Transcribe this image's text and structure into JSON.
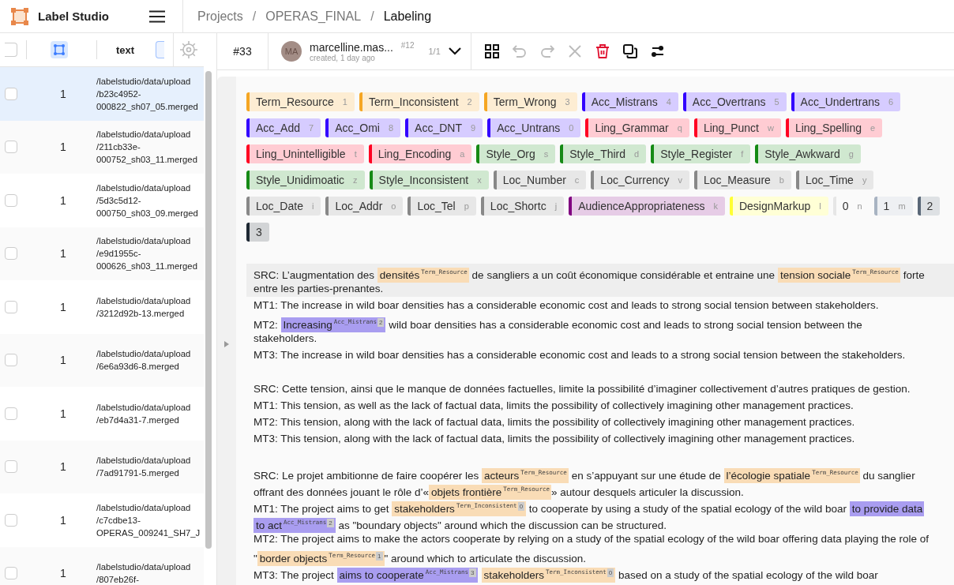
{
  "app": {
    "name": "Label Studio"
  },
  "breadcrumbs": [
    {
      "text": "Projects",
      "current": false
    },
    {
      "separator": "/",
      "text": "OPERAS_FINAL",
      "current": false
    },
    {
      "separator": "/",
      "text": "Labeling",
      "current": true
    }
  ],
  "table": {
    "all_checked": false,
    "header": "text",
    "rows": [
      {
        "selected": true,
        "checked": false,
        "count": "1",
        "lines": [
          "/labelstudio/data/upload",
          "/b23c4952-",
          "000822_sh07_05.merged"
        ]
      },
      {
        "selected": false,
        "checked": false,
        "count": "1",
        "lines": [
          "/labelstudio/data/upload",
          "/211cb33e-",
          "000752_sh03_11.merged"
        ]
      },
      {
        "selected": false,
        "checked": false,
        "count": "1",
        "lines": [
          "/labelstudio/data/upload",
          "/5d3c5d12-",
          "000750_sh03_09.merged"
        ]
      },
      {
        "selected": false,
        "checked": false,
        "count": "1",
        "lines": [
          "/labelstudio/data/upload",
          "/e9d1955c-",
          "000626_sh03_11.merged"
        ]
      },
      {
        "selected": false,
        "checked": false,
        "count": "1",
        "lines": [
          "/labelstudio/data/upload",
          "/3212d92b-13.merged"
        ]
      },
      {
        "selected": false,
        "checked": false,
        "count": "1",
        "lines": [
          "/labelstudio/data/upload",
          "/6e6a93d6-8.merged"
        ]
      },
      {
        "selected": false,
        "checked": false,
        "count": "1",
        "lines": [
          "/labelstudio/data/upload",
          "/eb7d4a31-7.merged"
        ]
      },
      {
        "selected": false,
        "checked": false,
        "count": "1",
        "lines": [
          "/labelstudio/data/upload",
          "/7ad91791-5.merged"
        ]
      },
      {
        "selected": false,
        "checked": false,
        "count": "1",
        "lines": [
          "/labelstudio/data/upload",
          "/c7cdbe13-",
          "OPERAS_009241_SH7_J"
        ]
      },
      {
        "selected": false,
        "checked": false,
        "count": "1",
        "lines": [
          "/labelstudio/data/upload",
          "/807eb26f-"
        ]
      }
    ]
  },
  "annotation": {
    "task": "#33",
    "avatar": "MA",
    "user": "marcelline.mas...",
    "created": "created, 1 day ago",
    "id": "#12",
    "pager": "1/1"
  },
  "toolbar": [
    {
      "kind": "grid",
      "disabled": false
    },
    {
      "kind": "undo",
      "disabled": true
    },
    {
      "kind": "redo",
      "disabled": true
    },
    {
      "kind": "close",
      "disabled": true
    },
    {
      "kind": "delete",
      "disabled": false
    },
    {
      "kind": "copy",
      "disabled": false
    },
    {
      "kind": "swap",
      "disabled": false
    }
  ],
  "labels": [
    {
      "name": "Term_Resource",
      "hotkey": "1",
      "color": "#f5a623"
    },
    {
      "name": "Term_Inconsistent",
      "hotkey": "2",
      "color": "#f5a623"
    },
    {
      "name": "Term_Wrong",
      "hotkey": "3",
      "color": "#f5a623"
    },
    {
      "name": "Acc_Mistrans",
      "hotkey": "4",
      "color": "#3300ff"
    },
    {
      "name": "Acc_Overtrans",
      "hotkey": "5",
      "color": "#3300ff"
    },
    {
      "name": "Acc_Undertrans",
      "hotkey": "6",
      "color": "#3300ff"
    },
    {
      "name": "Acc_Add",
      "hotkey": "7",
      "color": "#3300ff"
    },
    {
      "name": "Acc_Omi",
      "hotkey": "8",
      "color": "#3300ff"
    },
    {
      "name": "Acc_DNT",
      "hotkey": "9",
      "color": "#3300ff"
    },
    {
      "name": "Acc_Untrans",
      "hotkey": "0",
      "color": "#3300ff"
    },
    {
      "name": "Ling_Grammar",
      "hotkey": "q",
      "color": "#ff0022"
    },
    {
      "name": "Ling_Punct",
      "hotkey": "w",
      "color": "#ff0022"
    },
    {
      "name": "Ling_Spelling",
      "hotkey": "e",
      "color": "#ff0022"
    },
    {
      "name": "Ling_Unintelligible",
      "hotkey": "t",
      "color": "#ff0022"
    },
    {
      "name": "Ling_Encoding",
      "hotkey": "a",
      "color": "#ff0022"
    },
    {
      "name": "Style_Org",
      "hotkey": "s",
      "color": "#158a15"
    },
    {
      "name": "Style_Third",
      "hotkey": "d",
      "color": "#158a15"
    },
    {
      "name": "Style_Register",
      "hotkey": "f",
      "color": "#158a15"
    },
    {
      "name": "Style_Awkward",
      "hotkey": "g",
      "color": "#158a15"
    },
    {
      "name": "Style_Unidimoatic",
      "hotkey": "z",
      "color": "#158a15"
    },
    {
      "name": "Style_Inconsistent",
      "hotkey": "x",
      "color": "#158a15"
    },
    {
      "name": "Loc_Number",
      "hotkey": "c",
      "color": "#888888"
    },
    {
      "name": "Loc_Currency",
      "hotkey": "v",
      "color": "#888888"
    },
    {
      "name": "Loc_Measure",
      "hotkey": "b",
      "color": "#888888"
    },
    {
      "name": "Loc_Time",
      "hotkey": "y",
      "color": "#888888"
    },
    {
      "name": "Loc_Date",
      "hotkey": "i",
      "color": "#888888"
    },
    {
      "name": "Loc_Addr",
      "hotkey": "o",
      "color": "#888888"
    },
    {
      "name": "Loc_Tel",
      "hotkey": "p",
      "color": "#888888"
    },
    {
      "name": "Loc_Shortc",
      "hotkey": "j",
      "color": "#888888"
    },
    {
      "name": "AudienceAppropriateness",
      "hotkey": "k",
      "color": "#800080"
    },
    {
      "name": "DesignMarkup",
      "hotkey": "l",
      "color": "#ffff33"
    },
    {
      "name": "0",
      "hotkey": "n",
      "color": "#e6e6e6"
    },
    {
      "name": "1",
      "hotkey": "m",
      "color": "#a8b3c2"
    },
    {
      "name": "2",
      "color": "#5a6878"
    },
    {
      "name": "3",
      "color": "#1e2833"
    }
  ],
  "blocks": [
    {
      "lines": [
        {
          "shaded": true,
          "segments": [
            {
              "text": "SRC: L’augmentation des "
            },
            {
              "text": "densités",
              "label": "Term_Resource",
              "color": "#f9dcb6"
            },
            {
              "text": " de sangliers a un coût économique considérable et entraine une "
            },
            {
              "text": "tension sociale",
              "label": "Term_Resource",
              "color": "#f9dcb6"
            },
            {
              "text": " forte"
            }
          ]
        },
        {
          "shaded": true,
          "segments": [
            {
              "text": "entre les parties-prenantes."
            }
          ]
        },
        {
          "shaded": false,
          "segments": [
            {
              "text": "MT1: The increase in wild boar densities has a considerable economic cost and leads to strong social tension between stakeholders."
            }
          ]
        },
        {
          "shaded": false,
          "segments": [
            {
              "text": "MT2: "
            },
            {
              "text": "Increasing",
              "label": "Acc_Mistrans",
              "tag": "2",
              "color": "#a99df0"
            },
            {
              "text": " wild boar densities has a considerable economic cost and leads to strong social tension between the"
            }
          ]
        },
        {
          "shaded": false,
          "segments": [
            {
              "text": "stakeholders."
            }
          ]
        },
        {
          "shaded": false,
          "segments": [
            {
              "text": "MT3: The increase in wild boar densities has a considerable economic cost and leads to a strong social tension between the stakeholders."
            }
          ]
        }
      ]
    },
    {
      "lines": [
        {
          "shaded": false,
          "segments": [
            {
              "text": "SRC: Cette tension, ainsi que le manque de données factuelles, limite la possibilité d’imaginer collectivement d’autres pratiques de gestion."
            }
          ]
        },
        {
          "shaded": false,
          "segments": [
            {
              "text": "MT1: This tension, as well as the lack of factual data, limits the possibility of collectively imagining other management practices."
            }
          ]
        },
        {
          "shaded": false,
          "segments": [
            {
              "text": "MT2: This tension, along with the lack of factual data, limits the possibility of collectively imagining other management practices."
            }
          ]
        },
        {
          "shaded": false,
          "segments": [
            {
              "text": "MT3: This tension, along with the lack of factual data, limits the possibility of collectively imagining other management practices."
            }
          ]
        }
      ]
    },
    {
      "lines": [
        {
          "shaded": false,
          "segments": [
            {
              "text": "SRC: Le projet ambitionne de faire coopérer les "
            },
            {
              "text": "acteurs",
              "label": "Term_Resource",
              "color": "#f9dcb6"
            },
            {
              "text": " en s’appuyant sur une étude de "
            },
            {
              "text": "l’écologie spatiale",
              "label": "Term_Resource",
              "color": "#f9dcb6"
            },
            {
              "text": " du sanglier"
            }
          ]
        },
        {
          "shaded": false,
          "segments": [
            {
              "text": "offrant des données jouant le rôle d’«"
            },
            {
              "text": "objets frontière",
              "label": "Term_Resource",
              "color": "#f9dcb6"
            },
            {
              "text": "» autour desquels articuler la discussion."
            }
          ]
        },
        {
          "shaded": false,
          "segments": [
            {
              "text": "MT1: The project aims to get "
            },
            {
              "text": "stakeholders",
              "label": "Term_Inconsistent",
              "tag": "0",
              "color": "#f9dcb6"
            },
            {
              "text": " to cooperate by using a study of the spatial ecology of the wild boar "
            },
            {
              "text": "to provide data",
              "color": "#a99df0"
            }
          ]
        },
        {
          "shaded": false,
          "segments": [
            {
              "text": "to act",
              "label": "Acc_Mistrans",
              "tag": "2",
              "color": "#a99df0"
            },
            {
              "text": " as \"boundary objects\" around which the discussion can be structured."
            }
          ]
        },
        {
          "shaded": false,
          "segments": [
            {
              "text": "MT2: The project aims to make the actors cooperate by relying on a study of the spatial ecology of the wild boar offering data playing the role of"
            }
          ]
        },
        {
          "shaded": false,
          "segments": [
            {
              "text": "\""
            },
            {
              "text": "border objects",
              "label": "Term_Resource",
              "tag": "1",
              "color": "#f9dcb6"
            },
            {
              "text": "\" around which to articulate the discussion."
            }
          ]
        },
        {
          "shaded": false,
          "segments": [
            {
              "text": "MT3: The project "
            },
            {
              "text": "aims to cooperate",
              "label": "Acc_Mistrans",
              "tag": "3",
              "color": "#a99df0"
            },
            {
              "text": "stakeholders",
              "label": "Term_Inconsistent",
              "tag": "0",
              "color": "#f9dcb6"
            },
            {
              "text": " based on a study of the spatial ecology of the wild boar"
            }
          ]
        }
      ]
    }
  ]
}
